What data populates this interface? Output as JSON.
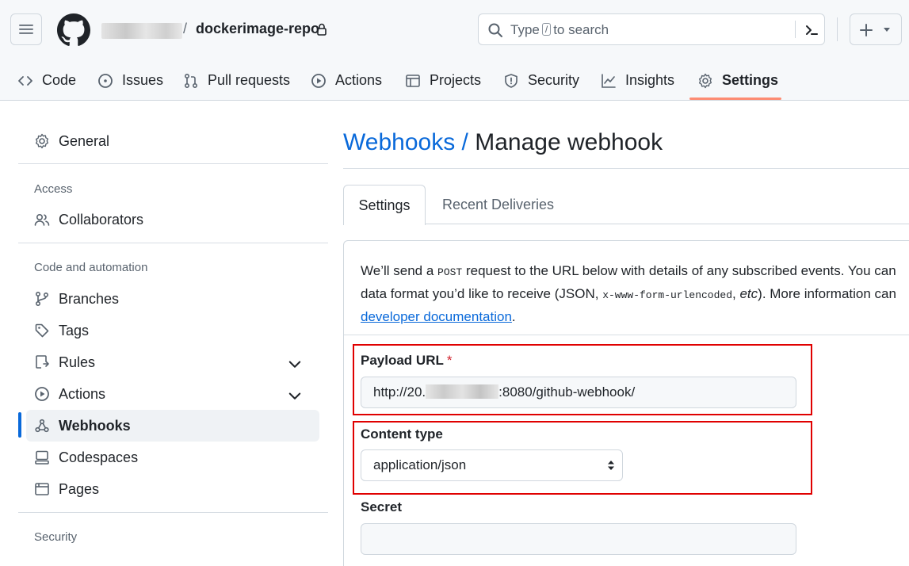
{
  "header": {
    "repo_name": "dockerimage-repo",
    "search_prefix": "Type",
    "search_key": "/",
    "search_suffix": "to search"
  },
  "repo_tabs": [
    {
      "label": "Code",
      "icon": "code-icon"
    },
    {
      "label": "Issues",
      "icon": "issue-opened-icon"
    },
    {
      "label": "Pull requests",
      "icon": "git-pull-request-icon"
    },
    {
      "label": "Actions",
      "icon": "play-icon"
    },
    {
      "label": "Projects",
      "icon": "table-icon"
    },
    {
      "label": "Security",
      "icon": "shield-icon"
    },
    {
      "label": "Insights",
      "icon": "graph-icon"
    },
    {
      "label": "Settings",
      "icon": "gear-icon",
      "selected": true
    }
  ],
  "sidebar": {
    "general": "General",
    "access_heading": "Access",
    "collaborators": "Collaborators",
    "code_heading": "Code and automation",
    "branches": "Branches",
    "tags": "Tags",
    "rules": "Rules",
    "actions": "Actions",
    "webhooks": "Webhooks",
    "codespaces": "Codespaces",
    "pages": "Pages",
    "security_heading": "Security",
    "active_item": "Webhooks"
  },
  "main": {
    "breadcrumb": "Webhooks",
    "breadcrumb_sep": "/",
    "title": "Manage webhook",
    "tab_settings": "Settings",
    "tab_deliveries": "Recent Deliveries",
    "intro_line1_a": "We’ll send a ",
    "intro_line1_code": "POST",
    "intro_line1_b": " request to the URL below with details of any subscribed events. You can",
    "intro_line2_a": "data format you’d like to receive (JSON, ",
    "intro_line2_code": "x-www-form-urlencoded",
    "intro_line2_b": ", ",
    "intro_line2_etc": "etc",
    "intro_line2_c": "). More information can",
    "intro_link": "developer documentation",
    "intro_end": "."
  },
  "form": {
    "payload_label": "Payload URL",
    "required_mark": "*",
    "payload_value_prefix": "http://20.",
    "payload_value_suffix": ":8080/github-webhook/",
    "content_type_label": "Content type",
    "content_type_value": "application/json",
    "secret_label": "Secret",
    "secret_value": ""
  },
  "colors": {
    "accent": "#0969da",
    "selected_tab_underline": "#fd8c73",
    "highlight_box": "#e00000"
  }
}
